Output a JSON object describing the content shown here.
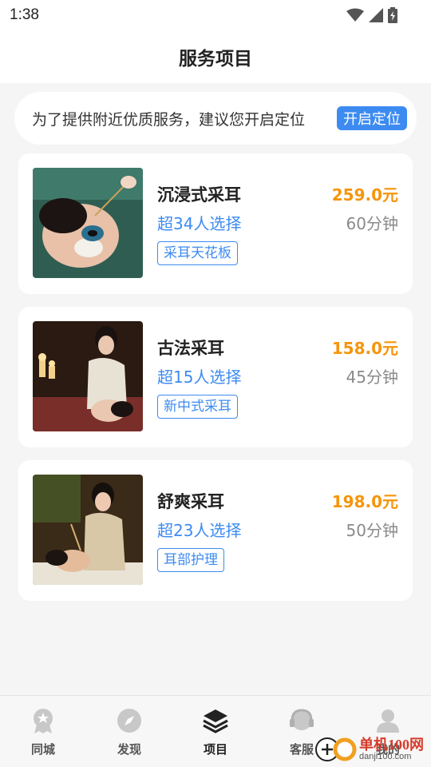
{
  "status_bar": {
    "time": "1:38"
  },
  "header": {
    "title": "服务项目"
  },
  "location_banner": {
    "text": "为了提供附近优质服务，建议您开启定位",
    "button_label": "开启定位"
  },
  "services": [
    {
      "name": "沉浸式采耳",
      "count_text": "超34人选择",
      "tag": "采耳天花板",
      "price": "259.0元",
      "duration": "60分钟"
    },
    {
      "name": "古法采耳",
      "count_text": "超15人选择",
      "tag": "新中式采耳",
      "price": "158.0元",
      "duration": "45分钟"
    },
    {
      "name": "舒爽采耳",
      "count_text": "超23人选择",
      "tag": "耳部护理",
      "price": "198.0元",
      "duration": "50分钟"
    }
  ],
  "bottom_nav": [
    {
      "label": "同城",
      "icon": "badge-icon",
      "active": false
    },
    {
      "label": "发现",
      "icon": "compass-icon",
      "active": false
    },
    {
      "label": "项目",
      "icon": "layers-icon",
      "active": true
    },
    {
      "label": "客服",
      "icon": "headset-icon",
      "active": false
    },
    {
      "label": "我的",
      "icon": "user-icon",
      "active": false
    }
  ],
  "watermark": {
    "text": "单机100网",
    "url": "danji100.com"
  },
  "colors": {
    "accent": "#3d8bf0",
    "price": "#f5950c",
    "muted": "#8a8a8a"
  }
}
